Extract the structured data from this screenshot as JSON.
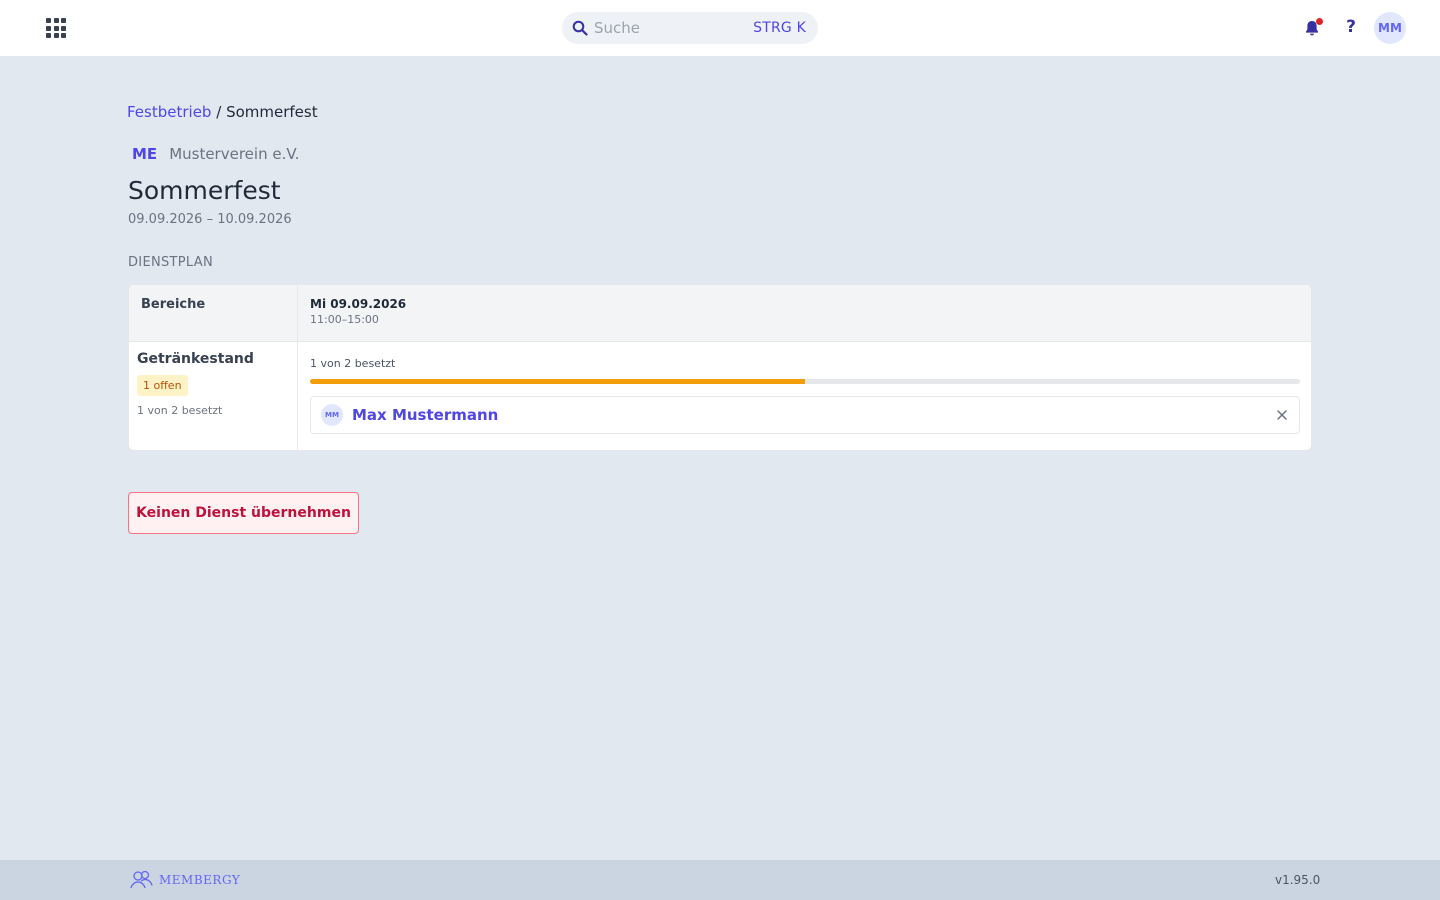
{
  "topbar": {
    "search_placeholder": "Suche",
    "search_shortcut": "STRG K",
    "help_label": "?",
    "user_initials": "MM",
    "notification_dot_color": "#dc2626"
  },
  "breadcrumb": {
    "parent": "Festbetrieb",
    "separator": "/",
    "current": "Sommerfest"
  },
  "organization": {
    "badge": "ME",
    "name": "Musterverein e.V."
  },
  "event": {
    "title": "Sommerfest",
    "date_range": "09.09.2026 – 10.09.2026"
  },
  "schedule": {
    "section_label": "DIENSTPLAN",
    "areas_header": "Bereiche",
    "day": {
      "label": "Mi 09.09.2026",
      "time": "11:00–15:00"
    },
    "areas": [
      {
        "name": "Getränkestand",
        "open_badge": "1 offen",
        "count_text": "1 von 2 besetzt",
        "shift": {
          "count_text": "1 von 2 besetzt",
          "filled": 1,
          "capacity": 2,
          "assignees": [
            {
              "initials": "MM",
              "name": "Max Mustermann"
            }
          ]
        }
      }
    ]
  },
  "actions": {
    "decline_label": "Keinen Dienst übernehmen"
  },
  "footer": {
    "brand": "MEMBERGY",
    "version": "v1.95.0"
  },
  "colors": {
    "accent": "#4f46e5",
    "progress": "#f59e0b",
    "danger": "#be123c",
    "background": "#e2e8f0"
  }
}
